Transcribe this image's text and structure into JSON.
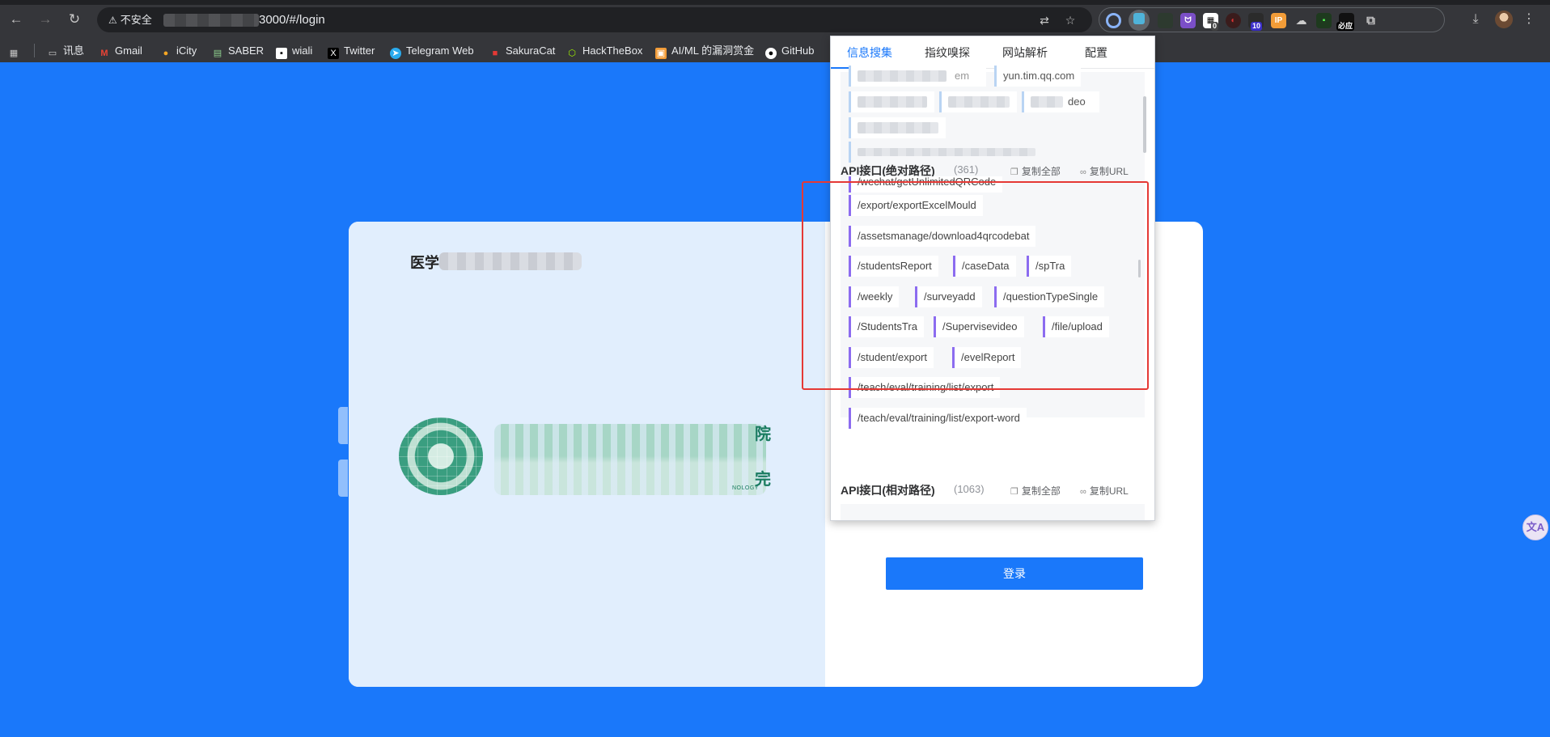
{
  "browser": {
    "security_label": "不安全",
    "url_visible": "3000/#/login",
    "ext_badges": [
      "0",
      "10"
    ],
    "ext_label_ip": "IP",
    "ext_label_bi": "必应"
  },
  "bookmarks": [
    {
      "label": "讯息",
      "icon": "folder-icon"
    },
    {
      "label": "Gmail",
      "icon": "gmail-icon"
    },
    {
      "label": "iCity",
      "icon": "icity-icon"
    },
    {
      "label": "SABER",
      "icon": "saber-icon"
    },
    {
      "label": "wiali",
      "icon": "wiali-icon"
    },
    {
      "label": "Twitter",
      "icon": "x-icon"
    },
    {
      "label": "Telegram Web",
      "icon": "telegram-icon"
    },
    {
      "label": "SakuraCat",
      "icon": "sakuracat-icon"
    },
    {
      "label": "HackTheBox",
      "icon": "hackthebox-icon"
    },
    {
      "label": "AI/ML 的漏洞赏金",
      "icon": "huntr-icon"
    },
    {
      "label": "GitHub",
      "icon": "github-icon"
    }
  ],
  "page": {
    "title_prefix": "医学",
    "login_button": "登录",
    "logo_small_text": "NOLOGY",
    "logo_char_1": "院",
    "logo_char_2": "完"
  },
  "popup": {
    "tabs": [
      "信息搜集",
      "指纹嗅探",
      "网站解析",
      "配置"
    ],
    "active_tab": 0,
    "domains": {
      "visible_text": [
        "yun.tim.qq.com",
        "em",
        "deo"
      ]
    },
    "api_absolute": {
      "title": "API接口(绝对路径)",
      "count": "(361)",
      "copy_all": "复制全部",
      "copy_url": "复制URL",
      "cut_top": "/wechat/getUnlimitedQRCode",
      "items": [
        "/export/exportExcelMould",
        "/assetsmanage/download4qrcodebat",
        "/studentsReport",
        "/caseData",
        "/spTra",
        "/weekly",
        "/surveyadd",
        "/questionTypeSingle",
        "/StudentsTra",
        "/Supervisevideo",
        "/file/upload",
        "/student/export",
        "/evelReport",
        "/teach/eval/training/list/export",
        "/teach/eval/training/list/export-word"
      ]
    },
    "api_relative": {
      "title": "API接口(相对路径)",
      "count": "(1063)",
      "copy_all": "复制全部",
      "copy_url": "复制URL"
    }
  },
  "float_button": {
    "label": "文A"
  },
  "colors": {
    "page_bg": "#1a78fa",
    "accent": "#1a78fa",
    "highlight_box": "#e53935",
    "api_chip_border": "#8c6cf0"
  }
}
